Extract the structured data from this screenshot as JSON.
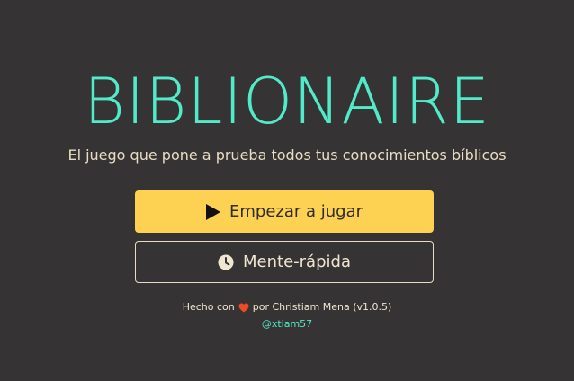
{
  "app": {
    "title": "BIBLIONAIRE",
    "subtitle": "El juego que pone a prueba todos tus conocimientos bíblicos"
  },
  "buttons": {
    "play_label": "Empezar a jugar",
    "quick_label": "Mente-rápida"
  },
  "footer": {
    "made_with": "Hecho con",
    "by_text": "por Christiam Mena (v1.0.5)",
    "handle": "@xtiam57"
  },
  "icons": {
    "play": "play-icon",
    "quick": "clock-icon",
    "heart": "heart-icon"
  },
  "colors": {
    "background": "#353333",
    "accent": "#52ebc9",
    "primary_button": "#fdd152",
    "text_light": "#e9dcc4",
    "heart": "#f04a22"
  }
}
